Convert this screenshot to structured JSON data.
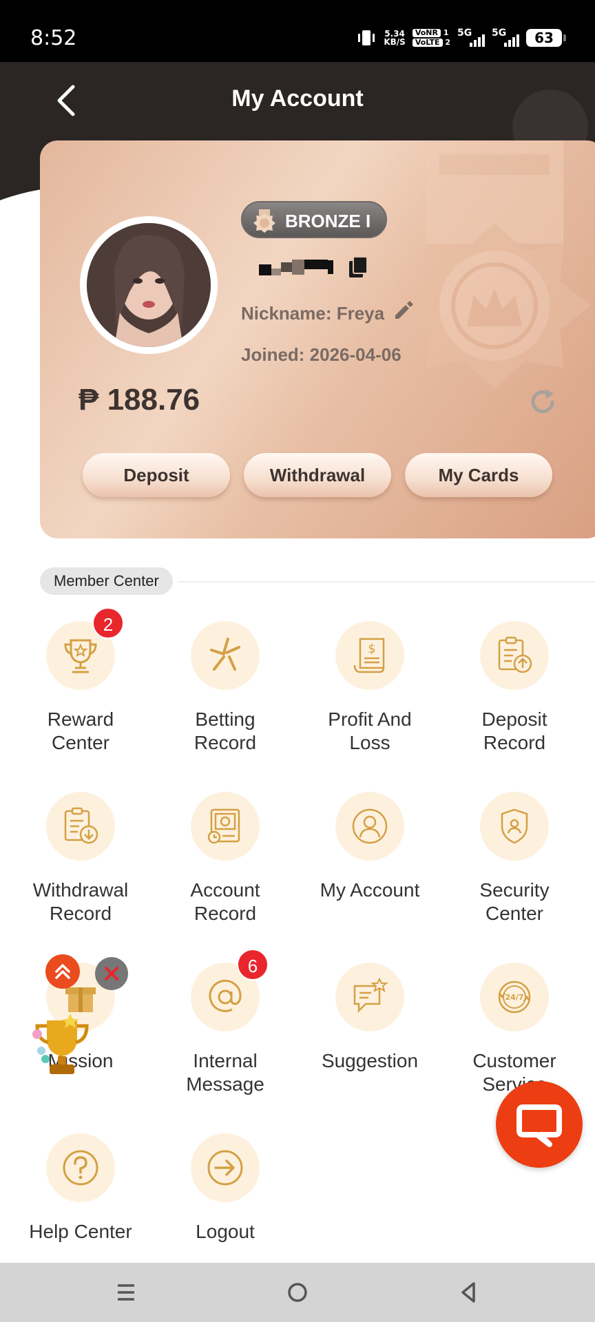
{
  "status_bar": {
    "time": "8:52",
    "speed_value": "5.34",
    "speed_unit": "KB/S",
    "volte_top": "VoNR",
    "volte_bottom": "VoLTE",
    "sim1": "1",
    "sim2": "2",
    "network1": "5G",
    "network2": "5G",
    "battery": "63"
  },
  "header": {
    "title": "My Account"
  },
  "card": {
    "level_badge": "BRONZE I",
    "nickname_label": "Nickname: Freya",
    "joined_label": "Joined:  2026-04-06",
    "balance": "₱ 188.76",
    "buttons": {
      "deposit": "Deposit",
      "withdrawal": "Withdrawal",
      "my_cards": "My Cards"
    }
  },
  "member_center": {
    "section_title": "Member Center",
    "items": [
      {
        "label": "Reward\nCenter",
        "icon": "trophy-icon",
        "badge": "2"
      },
      {
        "label": "Betting\nRecord",
        "icon": "betting-icon"
      },
      {
        "label": "Profit And\nLoss",
        "icon": "receipt-dollar-icon"
      },
      {
        "label": "Deposit\nRecord",
        "icon": "clipboard-upload-icon"
      },
      {
        "label": "Withdrawal\nRecord",
        "icon": "clipboard-download-icon"
      },
      {
        "label": "Account\nRecord",
        "icon": "account-record-icon"
      },
      {
        "label": "My Account",
        "icon": "user-circle-icon"
      },
      {
        "label": "Security\nCenter",
        "icon": "shield-user-icon"
      },
      {
        "label": "Mission",
        "icon": "gift-icon"
      },
      {
        "label": "Internal\nMessage",
        "icon": "at-sign-icon",
        "badge": "6"
      },
      {
        "label": "Suggestion",
        "icon": "chat-star-icon"
      },
      {
        "label": "Customer\nService",
        "icon": "support-24-7-icon"
      },
      {
        "label": "Help Center",
        "icon": "question-icon"
      },
      {
        "label": "Logout",
        "icon": "logout-icon"
      }
    ]
  },
  "colors": {
    "header_bg": "#2b2523",
    "accent_gold": "#d4a044",
    "icon_bg": "#fdf1de",
    "badge_red": "#e8262c",
    "chat_orange": "#ec3e12"
  }
}
